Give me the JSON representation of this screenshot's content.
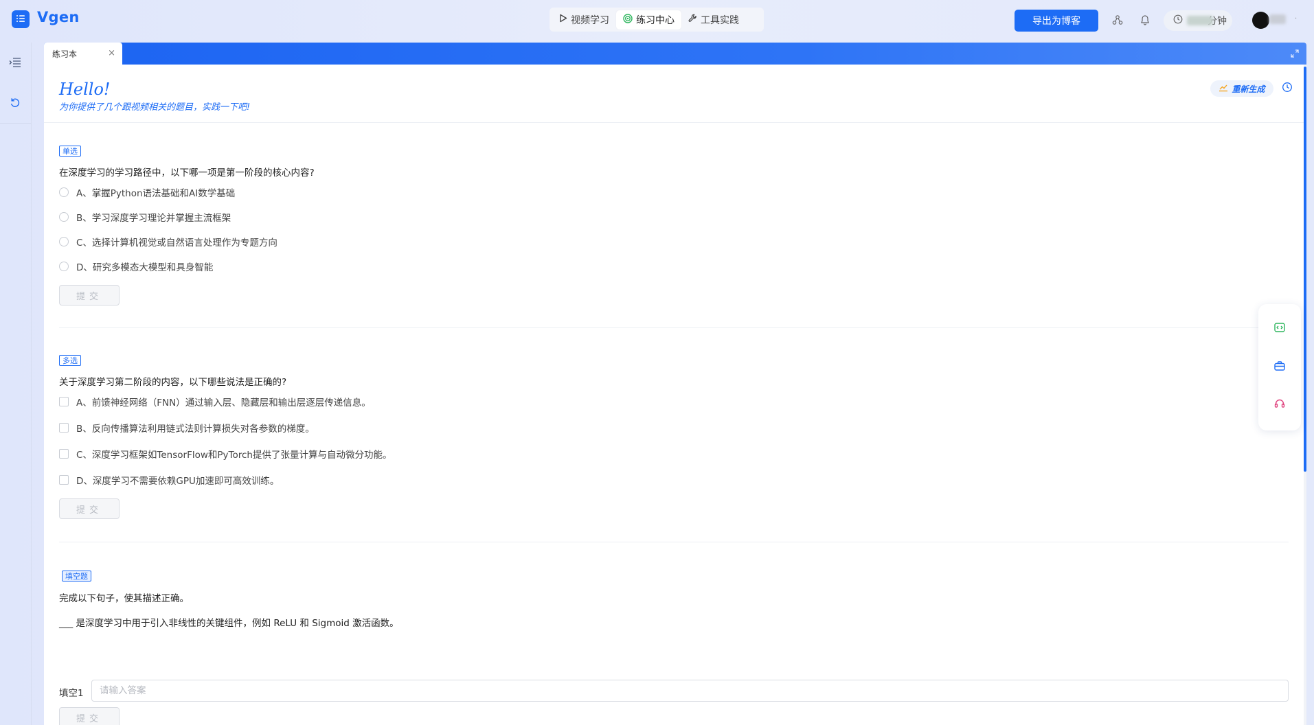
{
  "app": {
    "brand": "Vgen"
  },
  "nav": {
    "tabs": [
      {
        "label": "视频学习",
        "icon": "play-icon",
        "active": false
      },
      {
        "label": "练习中心",
        "icon": "target-icon",
        "active": true
      },
      {
        "label": "工具实践",
        "icon": "wrench-icon",
        "active": false
      }
    ]
  },
  "header": {
    "export_label": "导出为博客",
    "timer_unit": "分钟"
  },
  "workspace_tab": {
    "label": "练习本",
    "close": "×"
  },
  "intro": {
    "title": "Hello!",
    "subtitle": "为你提供了几个跟视频相关的题目，实践一下吧!",
    "regenerate_label": "重新生成"
  },
  "questions": [
    {
      "type_label": "单选",
      "text": "在深度学习的学习路径中，以下哪一项是第一阶段的核心内容?",
      "options": [
        "A、掌握Python语法基础和AI数学基础",
        "B、学习深度学习理论并掌握主流框架",
        "C、选择计算机视觉或自然语言处理作为专题方向",
        "D、研究多模态大模型和具身智能"
      ],
      "submit_label": "提交"
    },
    {
      "type_label": "多选",
      "text": "关于深度学习第二阶段的内容，以下哪些说法是正确的?",
      "options": [
        "A、前馈神经网络（FNN）通过输入层、隐藏层和输出层逐层传递信息。",
        "B、反向传播算法利用链式法则计算损失对各参数的梯度。",
        "C、深度学习框架如TensorFlow和PyTorch提供了张量计算与自动微分功能。",
        "D、深度学习不需要依赖GPU加速即可高效训练。"
      ],
      "submit_label": "提交"
    },
    {
      "type_label": "填空题",
      "text": "完成以下句子，使其描述正确。",
      "sentence": "___ 是深度学习中用于引入非线性的关键组件，例如 ReLU 和 Sigmoid 激活函数。",
      "blank_label": "填空1",
      "placeholder": "请输入答案",
      "value": "",
      "submit_label": "提交"
    }
  ],
  "colors": {
    "accent": "#1d6cf5",
    "float_green": "#2db55d",
    "float_blue": "#1d6cf5",
    "float_pink": "#e0437e"
  }
}
